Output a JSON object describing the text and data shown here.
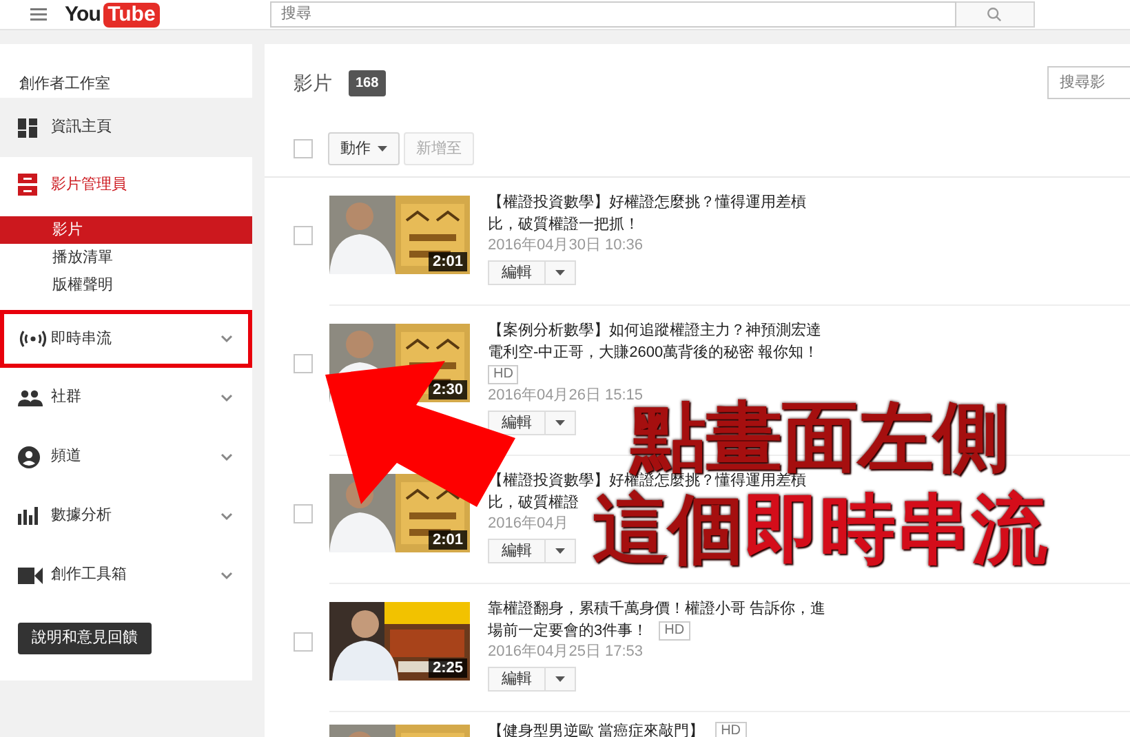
{
  "header": {
    "logo": {
      "left": "You",
      "right": "Tube"
    },
    "search": {
      "placeholder": "搜尋"
    }
  },
  "sidebar": {
    "title": "創作者工作室",
    "items": [
      {
        "label": "資訊主頁",
        "kind": "link",
        "hovered": true,
        "active": false,
        "annotated": false
      },
      {
        "label": "影片管理員",
        "kind": "group",
        "hovered": false,
        "active": true,
        "annotated": false,
        "expanded": true,
        "children": [
          {
            "label": "影片",
            "selected": true
          },
          {
            "label": "播放清單",
            "selected": false
          },
          {
            "label": "版權聲明",
            "selected": false
          }
        ]
      },
      {
        "label": "即時串流",
        "kind": "section",
        "hovered": false,
        "active": false,
        "annotated": true,
        "expanded": false
      },
      {
        "label": "社群",
        "kind": "section",
        "hovered": false,
        "active": false,
        "annotated": false,
        "expanded": false
      },
      {
        "label": "頻道",
        "kind": "section",
        "hovered": false,
        "active": false,
        "annotated": false,
        "expanded": false
      },
      {
        "label": "數據分析",
        "kind": "section",
        "hovered": false,
        "active": false,
        "annotated": false,
        "expanded": false
      },
      {
        "label": "創作工具箱",
        "kind": "section",
        "hovered": false,
        "active": false,
        "annotated": false,
        "expanded": false
      }
    ],
    "help_button": "說明和意見回饋"
  },
  "main": {
    "title": "影片",
    "count": "168",
    "search": {
      "placeholder": "搜尋影"
    },
    "select_all": {
      "checked": false
    },
    "toolbar": [
      {
        "label": "動作",
        "kind": "dropdown",
        "disabled": false
      },
      {
        "label": "新增至",
        "kind": "button",
        "disabled": true
      }
    ],
    "videos": [
      {
        "checked": false,
        "thumbnail": {
          "kind": "picture",
          "duration": "2:01"
        },
        "title_lines": [
          {
            "text": "【權證投資數學】好權證怎麼挑？懂得運用差槓"
          },
          {
            "text": "比，破質權證一把抓！"
          }
        ],
        "date": "2016年04月30日 10:36",
        "edit": "編輯"
      },
      {
        "checked": false,
        "thumbnail": {
          "kind": "picture",
          "duration": "2:30"
        },
        "title_lines": [
          {
            "text": "【案例分析數學】如何追蹤權證主力？神預測宏達"
          },
          {
            "text": "電利空-中正哥，大賺2600萬背後的秘密 報你知！"
          },
          {
            "badge": "HD"
          }
        ],
        "date": "2016年04月26日 15:15",
        "edit": "編輯"
      },
      {
        "checked": false,
        "thumbnail": {
          "kind": "picture",
          "duration": "2:01"
        },
        "title_lines": [
          {
            "text": "【權證投資數學】好權證怎麼挑？懂得運用差槓"
          },
          {
            "text": "比，破質權證"
          }
        ],
        "date": "2016年04月",
        "edit": "編輯"
      },
      {
        "checked": false,
        "thumbnail": {
          "kind": "picture",
          "duration": "2:25"
        },
        "title_lines": [
          {
            "text": "靠權證翻身，累積千萬身價！權證小哥 告訴你，進"
          },
          {
            "text": "場前一定要會的3件事！",
            "badge": "HD"
          }
        ],
        "date": "2016年04月25日 17:53",
        "edit": "編輯"
      },
      {
        "thumbnail": {
          "kind": "picture"
        },
        "title_lines": [
          {
            "text": "【健身型男逆歐 當癌症來敲門】",
            "badge": "HD"
          }
        ]
      }
    ]
  },
  "annotation": {
    "lines": [
      {
        "segments": [
          {
            "text": "點畫面左側",
            "color": "#a50f0f"
          }
        ]
      },
      {
        "segments": [
          {
            "text": "這個",
            "color": "#a50f0f"
          },
          {
            "text": "即時串流",
            "color": "#d40d1a"
          }
        ]
      }
    ]
  }
}
